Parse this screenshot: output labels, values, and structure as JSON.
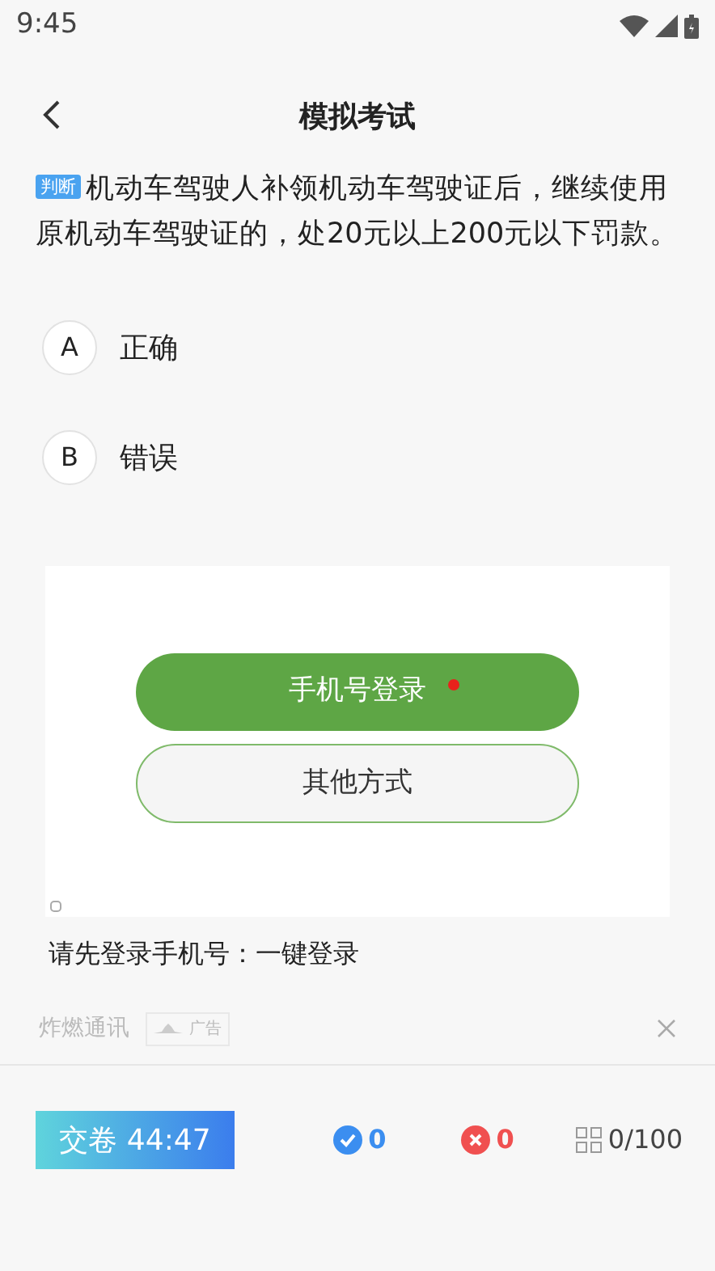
{
  "status_bar": {
    "time": "9:45"
  },
  "header": {
    "title": "模拟考试"
  },
  "question": {
    "type_tag": "判断",
    "text": "机动车驾驶人补领机动车驾驶证后，继续使用原机动车驾驶证的，处20元以上200元以下罚款。"
  },
  "options": [
    {
      "letter": "A",
      "label": "正确",
      "selected": false
    },
    {
      "letter": "B",
      "label": "错误",
      "selected": false
    }
  ],
  "ad": {
    "primary_button": "手机号登录",
    "primary_dot": true,
    "secondary_button": "其他方式",
    "caption": "请先登录手机号：一键登录",
    "source": "炸燃通讯",
    "badge": "广告"
  },
  "bottom_bar": {
    "submit": "交卷 44:47",
    "correct": "0",
    "wrong": "0",
    "progress": "0/100"
  }
}
